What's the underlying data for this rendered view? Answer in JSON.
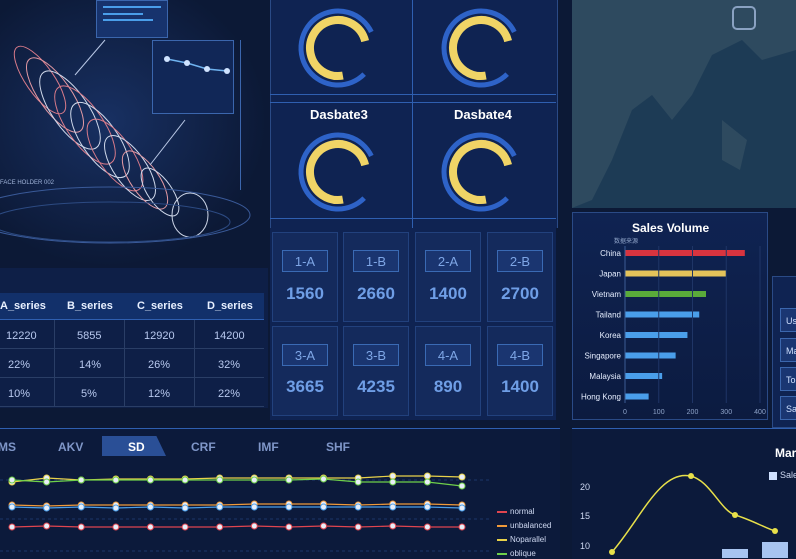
{
  "dashboard": {
    "top_left": {
      "placeholder_text": "FACE HOLDER 002"
    },
    "table": {
      "headers": [
        "A_series",
        "B_series",
        "C_series",
        "D_series"
      ],
      "rows": [
        [
          "12220",
          "5855",
          "12920",
          "14200"
        ],
        [
          "22%",
          "14%",
          "26%",
          "32%"
        ],
        [
          "10%",
          "5%",
          "12%",
          "22%"
        ]
      ]
    },
    "gauges": [
      {
        "label": "",
        "fraction": 0.82
      },
      {
        "label": "",
        "fraction": 0.82
      },
      {
        "label": "Dasbate3",
        "fraction": 0.82
      },
      {
        "label": "Dasbate4",
        "fraction": 0.82
      }
    ],
    "code_cells": [
      {
        "code": "1-A",
        "value": "1560"
      },
      {
        "code": "1-B",
        "value": "2660"
      },
      {
        "code": "2-A",
        "value": "1400"
      },
      {
        "code": "2-B",
        "value": "2700"
      },
      {
        "code": "3-A",
        "value": "3665"
      },
      {
        "code": "3-B",
        "value": "4235"
      },
      {
        "code": "4-A",
        "value": "890"
      },
      {
        "code": "4-B",
        "value": "1400"
      }
    ],
    "tabs": [
      "MS",
      "AKV",
      "SD",
      "CRF",
      "IMF",
      "SHF"
    ],
    "active_tab": "SD",
    "bottom_legend": [
      {
        "name": "normal",
        "color": "#e0454f"
      },
      {
        "name": "unbalanced",
        "color": "#f09a3a"
      },
      {
        "name": "Noparallel",
        "color": "#e8d24a"
      },
      {
        "name": "oblique",
        "color": "#6fd04a"
      }
    ],
    "right_buttons": [
      "Us",
      "Ma",
      "To",
      "Sa"
    ],
    "bottom_right": {
      "title": "Mar",
      "legend_label": "Sale",
      "y_ticks": [
        "20",
        "15",
        "10"
      ]
    }
  },
  "chart_data": [
    {
      "type": "bar",
      "title": "Sales Volume",
      "subtitle": "数据来源",
      "categories": [
        "China",
        "Japan",
        "Vietnam",
        "Tailand",
        "Korea",
        "Singapore",
        "Malaysia",
        "Hong Kong"
      ],
      "values": [
        355,
        300,
        240,
        220,
        185,
        150,
        110,
        70
      ],
      "colors": [
        "#d8343f",
        "#e4c35a",
        "#5aab3a",
        "#4a9eea",
        "#4a9eea",
        "#4a9eea",
        "#4a9eea",
        "#4a9eea"
      ],
      "xlim": [
        0,
        400
      ],
      "x_ticks": [
        "0",
        "100",
        "200",
        "300",
        "400"
      ]
    },
    {
      "type": "line",
      "title": "",
      "x": [
        1,
        2,
        3,
        4,
        5,
        6,
        7,
        8,
        9,
        10,
        11,
        12,
        13,
        14
      ],
      "series": [
        {
          "values": [
            80,
            84,
            82,
            83,
            83,
            83,
            84,
            84,
            84,
            84,
            84,
            86,
            86,
            85
          ],
          "color": "#e8d24a"
        },
        {
          "values": [
            82,
            80,
            82,
            82,
            82,
            82,
            82,
            82,
            82,
            83,
            80,
            80,
            80,
            76
          ],
          "color": "#6fd04a"
        },
        {
          "values": [
            57,
            56,
            57,
            57,
            57,
            57,
            57,
            58,
            58,
            58,
            57,
            58,
            58,
            57
          ],
          "color": "#f09a3a"
        },
        {
          "values": [
            55,
            54,
            55,
            54,
            55,
            54,
            55,
            55,
            55,
            55,
            55,
            55,
            55,
            54
          ],
          "color": "#4a9eea"
        },
        {
          "values": [
            35,
            36,
            35,
            35,
            35,
            35,
            35,
            36,
            35,
            36,
            35,
            36,
            35,
            35
          ],
          "color": "#e0454f"
        }
      ],
      "ylim": [
        0,
        100
      ]
    }
  ]
}
